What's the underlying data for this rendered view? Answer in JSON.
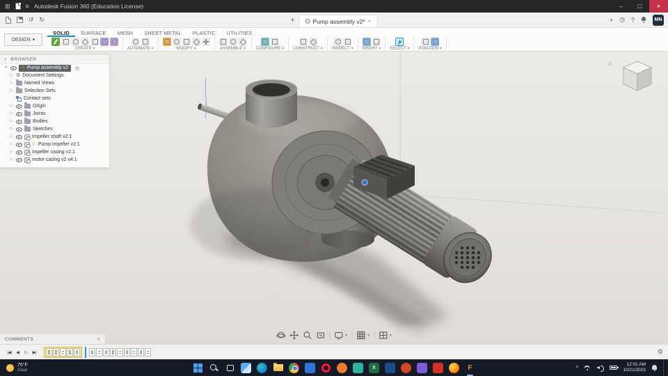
{
  "titlebar": {
    "app_title": "Autodesk Fusion 360 (Education License)"
  },
  "doc_tab": {
    "label": "Pump assembly v2*"
  },
  "user": {
    "initials": "MN"
  },
  "design_menu_label": "DESIGN",
  "ribbon_tabs": [
    "SOLID",
    "SURFACE",
    "MESH",
    "SHEET METAL",
    "PLASTIC",
    "UTILITIES"
  ],
  "toolbar_groups": [
    "CREATE",
    "AUTOMATE",
    "MODIFY",
    "ASSEMBLE",
    "CONFIGURE",
    "CONSTRUCT",
    "INSPECT",
    "INSERT",
    "SELECT",
    "POSITION"
  ],
  "browser": {
    "title": "BROWSER",
    "root_label": "Pump assembly v2",
    "items": [
      "Document Settings",
      "Named Views",
      "Selection Sets",
      "Contact sets",
      "Origin",
      "Joints",
      "Bodies",
      "Sketches",
      "Impeller shaft v2:1",
      "Pump impeller v2:1",
      "impeller casing v1:1",
      "motor casing v2 v4:1"
    ]
  },
  "comments_bar": {
    "label": "COMMENTS"
  },
  "taskbar": {
    "weather_temp": "76°F",
    "weather_desc": "Clear",
    "clock_time": "12:01 AM",
    "clock_date": "10/21/2023",
    "fusion_letter": "F",
    "excel_letter": "X"
  },
  "icons": {
    "app_grid": "⊞",
    "menu": "≡",
    "minimize": "–",
    "maximize": "□",
    "close": "×",
    "plus": "+",
    "clock": "◷",
    "help": "?",
    "undo": "↺",
    "redo": "↻",
    "caret_down": "▾",
    "tree_expand": "▷",
    "tree_open": "▾",
    "warning": "⚠",
    "gear": "⚙",
    "activate": "◎",
    "collapse": "«",
    "home": "⌂",
    "skip_start": "|◀",
    "step_back": "◀",
    "play": "▷",
    "skip_end": "▶|",
    "tray_up": "^",
    "tab_close": "×"
  },
  "colors": {
    "accent_blue": "#0696d7",
    "selection_yellow": "#f3e382",
    "warning_yellow": "#e3a117",
    "fusion_orange": "#ff8a1e"
  }
}
